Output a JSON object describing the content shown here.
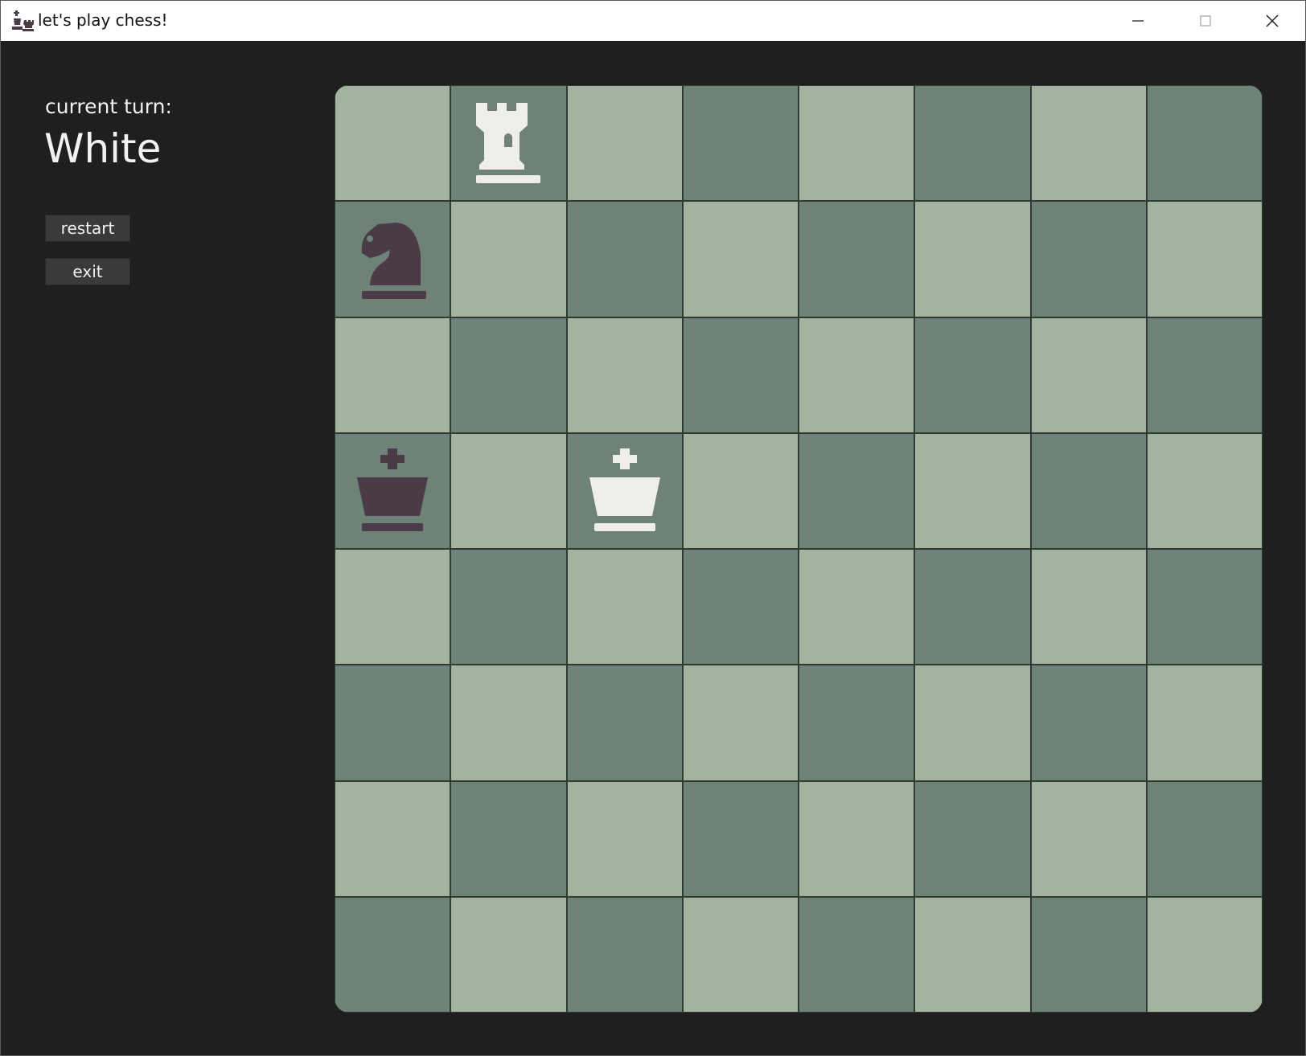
{
  "window": {
    "title": "let's play chess!",
    "icon": "chess-app-icon",
    "controls": [
      "minimize-icon",
      "maximize-icon",
      "close-icon"
    ]
  },
  "sidebar": {
    "turn_label": "current turn:",
    "turn_value": "White",
    "buttons": {
      "restart": "restart",
      "exit": "exit"
    }
  },
  "board": {
    "colors": {
      "light": "#a4b3a0",
      "dark": "#6f8277",
      "white_piece": "#f0eeea",
      "black_piece": "#4a3b47"
    },
    "squares": [
      [
        "light",
        "dark",
        "light",
        "dark",
        "light",
        "dark",
        "light",
        "dark"
      ],
      [
        "dark",
        "light",
        "dark",
        "light",
        "dark",
        "light",
        "dark",
        "light"
      ],
      [
        "light",
        "dark",
        "light",
        "dark",
        "light",
        "dark",
        "light",
        "dark"
      ],
      [
        "dark",
        "light",
        "dark",
        "light",
        "dark",
        "light",
        "dark",
        "light"
      ],
      [
        "light",
        "dark",
        "light",
        "dark",
        "light",
        "dark",
        "light",
        "dark"
      ],
      [
        "dark",
        "light",
        "dark",
        "light",
        "dark",
        "light",
        "dark",
        "light"
      ],
      [
        "light",
        "dark",
        "light",
        "dark",
        "light",
        "dark",
        "light",
        "dark"
      ],
      [
        "dark",
        "light",
        "dark",
        "light",
        "dark",
        "light",
        "dark",
        "light"
      ]
    ],
    "pieces": [
      {
        "row": 0,
        "col": 1,
        "type": "rook",
        "color": "white"
      },
      {
        "row": 1,
        "col": 0,
        "type": "knight",
        "color": "black"
      },
      {
        "row": 3,
        "col": 0,
        "type": "king",
        "color": "black"
      },
      {
        "row": 3,
        "col": 2,
        "type": "king",
        "color": "white"
      }
    ]
  }
}
